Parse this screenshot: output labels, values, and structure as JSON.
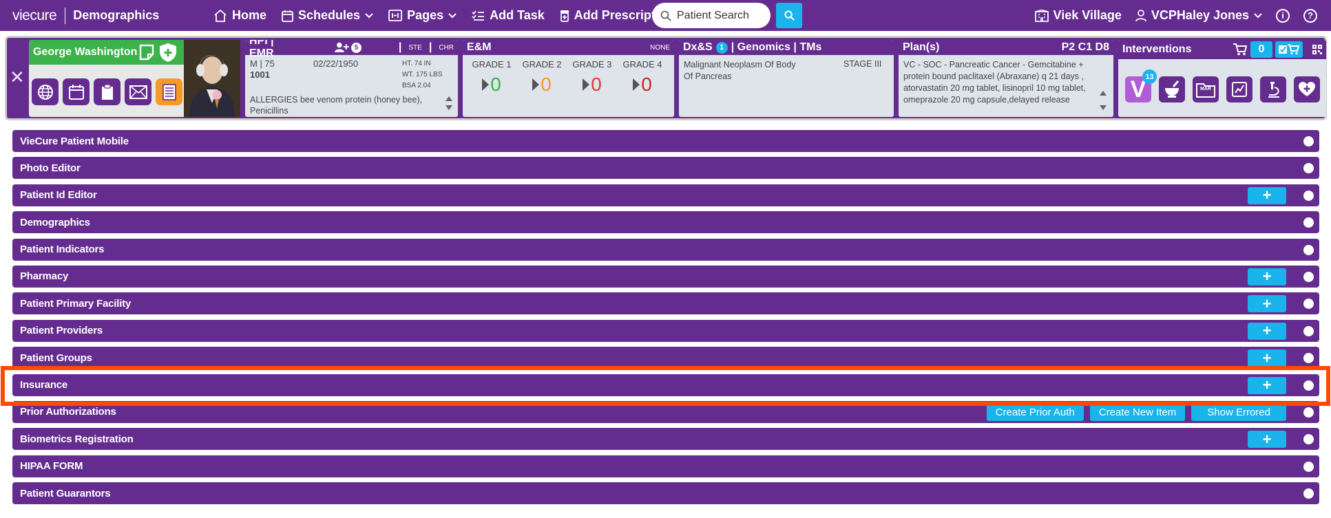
{
  "header": {
    "logo": "viecure",
    "page_title": "Demographics",
    "nav": [
      {
        "label": "Home",
        "icon": "home-icon"
      },
      {
        "label": "Schedules",
        "icon": "calendar-icon"
      },
      {
        "label": "Pages",
        "icon": "pages-icon"
      },
      {
        "label": "Add Task",
        "icon": "task-list-icon"
      },
      {
        "label": "Add Prescription",
        "icon": "prescription-icon"
      }
    ],
    "search_placeholder": "Patient Search",
    "location": "Viek Village",
    "user": "VCPHaley Jones",
    "info_glyph": "i",
    "help_glyph": "?"
  },
  "patient": {
    "name": "George Washington",
    "hpi": {
      "title": "HPI | EMR",
      "badge": "5",
      "ste": "STE",
      "chr": "CHR",
      "sex_age": "M | 75",
      "dob": "02/22/1950",
      "mrn": "1001",
      "height": "HT. 74 IN",
      "weight": "WT. 175 LBS",
      "bsa": "BSA 2.04",
      "allergies": "ALLERGIES bee venom protein (honey bee), Penicillins"
    },
    "em": {
      "title": "E&M",
      "status": "NONE",
      "grades": [
        {
          "label": "GRADE 1",
          "value": "0",
          "color": "#3bb34a"
        },
        {
          "label": "GRADE 2",
          "value": "0",
          "color": "#f59a23"
        },
        {
          "label": "GRADE 3",
          "value": "0",
          "color": "#e53935"
        },
        {
          "label": "GRADE 4",
          "value": "0",
          "color": "#c62828"
        }
      ]
    },
    "dxs": {
      "title_prefix": "Dx&S",
      "badge": "1",
      "title_suffix": "| Genomics | TMs",
      "diagnosis": "Malignant Neoplasm Of Body Of Pancreas",
      "stage": "STAGE III"
    },
    "plan": {
      "title": "Plan(s)",
      "codes": "P2 C1 D8",
      "text": "VC - SOC - Pancreatic Cancer - Gemcitabine + protein bound paclitaxel (Abraxane) q 21 days , atorvastatin 20 mg tablet, lisinopril 10 mg tablet, omeprazole 20 mg capsule,delayed release"
    },
    "interventions": {
      "title": "Interventions",
      "cart_count": "0",
      "v_letter": "V",
      "v_badge": "13",
      "mar_label": "MAR"
    }
  },
  "sections": [
    {
      "label": "VieCure Patient Mobile",
      "plus": false
    },
    {
      "label": "Photo Editor",
      "plus": false
    },
    {
      "label": "Patient Id Editor",
      "plus": true
    },
    {
      "label": "Demographics",
      "plus": false
    },
    {
      "label": "Patient Indicators",
      "plus": false
    },
    {
      "label": "Pharmacy",
      "plus": true
    },
    {
      "label": "Patient Primary Facility",
      "plus": true
    },
    {
      "label": "Patient Providers",
      "plus": true
    },
    {
      "label": "Patient Groups",
      "plus": true
    },
    {
      "label": "Insurance",
      "plus": true
    },
    {
      "label": "Prior Authorizations",
      "actions": [
        "Create Prior Auth",
        "Create New Item",
        "Show Errored"
      ]
    },
    {
      "label": "Biometrics Registration",
      "plus": true
    },
    {
      "label": "HIPAA FORM",
      "plus": false
    },
    {
      "label": "Patient Guarantors",
      "plus": false
    }
  ],
  "plus_glyph": "+",
  "close_glyph": "✕",
  "colors": {
    "primary": "#652c8f",
    "accent": "#19b4ec",
    "green": "#3bb34a",
    "highlight": "#ff4a00"
  }
}
